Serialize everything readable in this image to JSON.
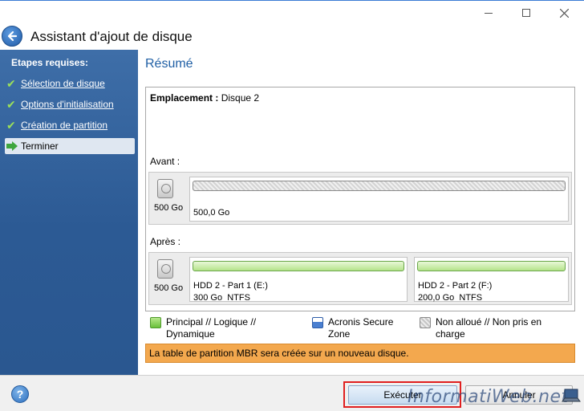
{
  "window": {
    "title": "Assistant d'ajout de disque"
  },
  "sidebar": {
    "heading": "Etapes requises:",
    "steps": [
      {
        "label": "Sélection de disque",
        "status": "done"
      },
      {
        "label": "Options d'initialisation",
        "status": "done"
      },
      {
        "label": "Création de partition",
        "status": "done"
      },
      {
        "label": "Terminer",
        "status": "current"
      }
    ]
  },
  "main": {
    "title": "Résumé",
    "location_label": "Emplacement :",
    "location_value": "Disque 2",
    "before": {
      "label": "Avant :",
      "disk_size": "500 Go",
      "partitions": [
        {
          "type": "unallocated",
          "size": "500,0 Go"
        }
      ]
    },
    "after": {
      "label": "Après :",
      "disk_size": "500 Go",
      "partitions": [
        {
          "type": "primary",
          "name": "HDD 2 - Part 1 (E:)",
          "size": "300 Go",
          "fs": "NTFS"
        },
        {
          "type": "primary",
          "name": "HDD 2 - Part 2 (F:)",
          "size": "200,0 Go",
          "fs": "NTFS"
        }
      ]
    },
    "legend": [
      {
        "label": "Principal // Logique // Dynamique",
        "color": "#6ac03a"
      },
      {
        "label": "Acronis Secure Zone",
        "color": "#4a7fd0"
      },
      {
        "label": "Non alloué // Non pris en charge",
        "color": "#c6c6c6"
      }
    ],
    "info": "La table de partition MBR sera créée sur un nouveau disque."
  },
  "buttons": {
    "help": "?",
    "execute": "Exécuter",
    "cancel": "Annuler"
  },
  "watermark": "InformatiWeb.net"
}
